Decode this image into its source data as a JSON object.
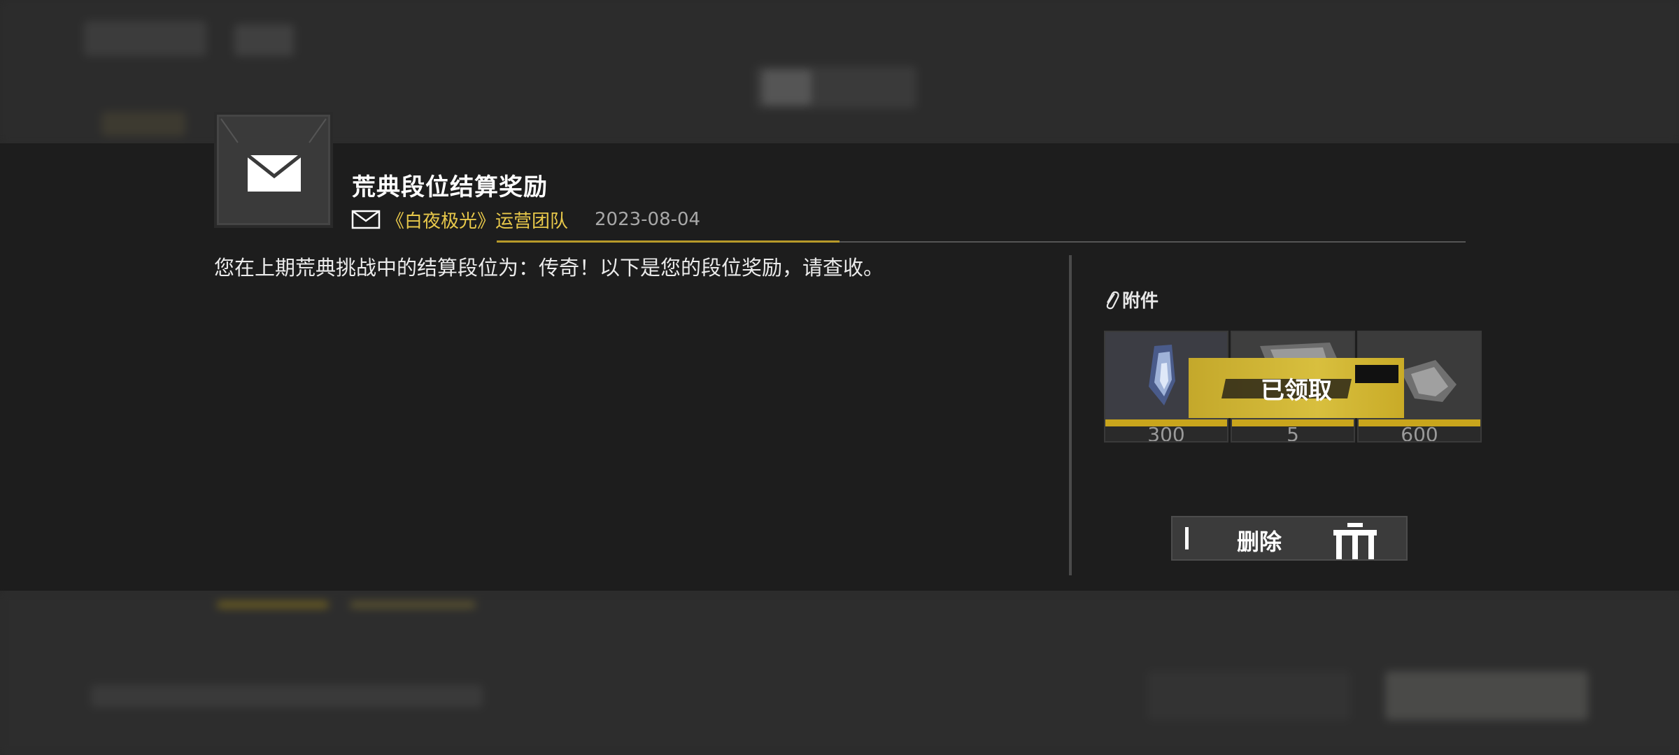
{
  "mail": {
    "title": "荒典段位结算奖励",
    "sender": "《白夜极光》运营团队",
    "date": "2023-08-04",
    "body": "您在上期荒典挑战中的结算段位为：传奇！以下是您的段位奖励，请查收。",
    "attachments_label": "附件",
    "attachments": [
      {
        "icon": "crystal-item-icon",
        "quantity": "300"
      },
      {
        "icon": "fragment-item-icon",
        "quantity": "5"
      },
      {
        "icon": "ore-item-icon",
        "quantity": "600"
      }
    ],
    "claimed_label": "已领取",
    "delete_label": "删除"
  },
  "colors": {
    "accent": "#c9a51c",
    "sender": "#e8c84a",
    "modal_bg": "#1d1d1d",
    "page_bg": "#2a2a2a"
  }
}
